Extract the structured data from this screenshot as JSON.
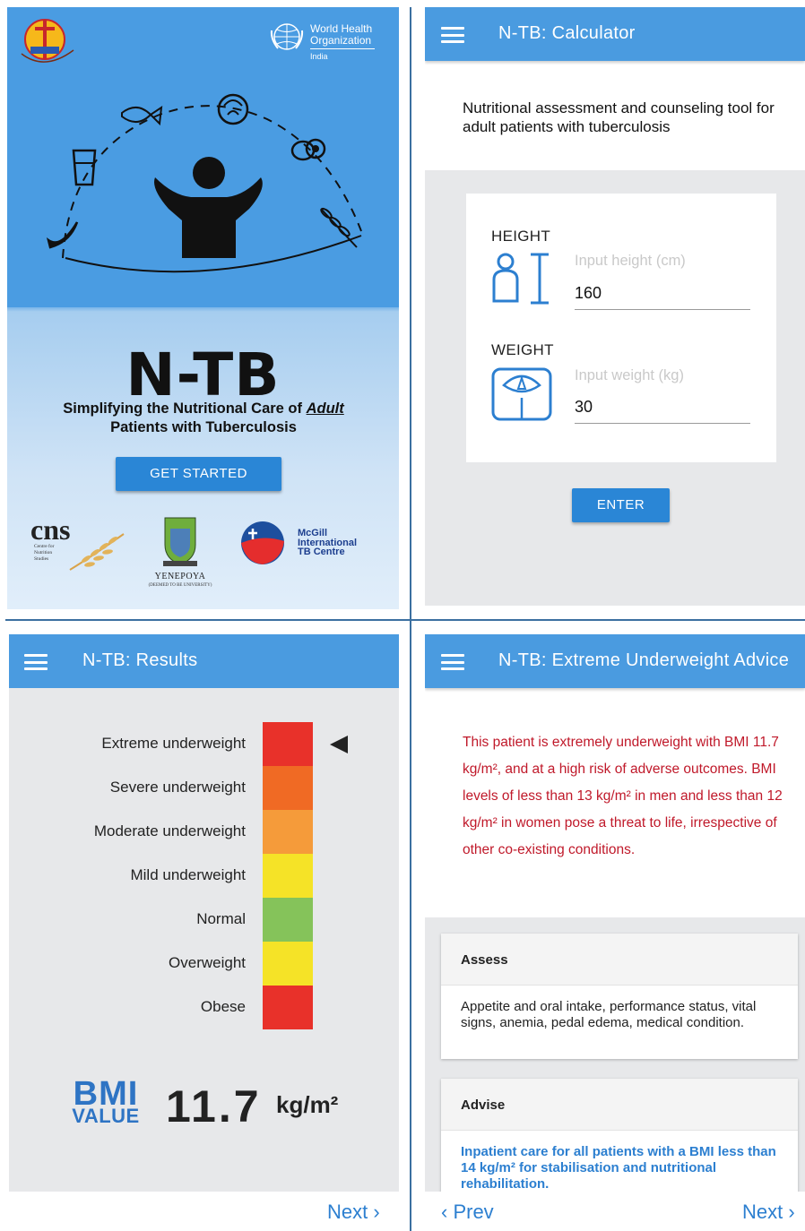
{
  "splash": {
    "org_name_1": "World Health",
    "org_name_2": "Organization",
    "org_country": "India",
    "app_title": "N-TB",
    "subtitle_1": "Simplifying the Nutritional Care of ",
    "subtitle_em": "Adult",
    "subtitle_2": "Patients with Tuberculosis",
    "cta": "GET STARTED",
    "partner_cns": "cns",
    "partner_cns_sub": [
      "Centre for",
      "Nutrition",
      "Studies"
    ],
    "partner_yenepoya": "YENEPOYA",
    "partner_yenepoya_sub": "(DEEMED TO BE UNIVERSITY)",
    "partner_mcgill": [
      "McGill",
      "International",
      "TB Centre"
    ]
  },
  "calculator": {
    "title": "N-TB: Calculator",
    "intro": "Nutritional assessment and counseling tool for adult patients with tuberculosis",
    "height_label": "HEIGHT",
    "height_placeholder": "Input height (cm)",
    "height_value": "160",
    "weight_label": "WEIGHT",
    "weight_placeholder": "Input weight (kg)",
    "weight_value": "30",
    "enter_label": "ENTER"
  },
  "results": {
    "title": "N-TB: Results",
    "categories": [
      {
        "label": "Extreme underweight",
        "color": "#e8312a"
      },
      {
        "label": "Severe underweight",
        "color": "#f06a24"
      },
      {
        "label": "Moderate underweight",
        "color": "#f59b3a"
      },
      {
        "label": "Mild underweight",
        "color": "#f5e327"
      },
      {
        "label": "Normal",
        "color": "#85c35a"
      },
      {
        "label": "Overweight",
        "color": "#f5e327"
      },
      {
        "label": "Obese",
        "color": "#e8312a"
      }
    ],
    "selected_category": "Extreme underweight",
    "bmi_word": "BMI",
    "bmi_value_word": "VALUE",
    "bmi_value": "11.7",
    "bmi_unit": "kg/m²",
    "next_label": "Next ›"
  },
  "advice": {
    "title": "N-TB: Extreme Underweight Advice",
    "message": "This patient is extremely underweight with BMI 11.7 kg/m², and at a high risk of adverse outcomes. BMI levels of less than 13 kg/m² in men and less than 12 kg/m²  in women pose a threat to life, irrespective of other co-existing conditions.",
    "assess_title": "Assess",
    "assess_body": "Appetite and oral intake, performance status, vital signs, anemia, pedal edema, medical condition.",
    "advise_title": "Advise",
    "advise_body": "Inpatient care for all patients with a BMI less than 14 kg/m² for stabilisation and nutritional rehabilitation.",
    "prev_label": "‹ Prev",
    "next_label": "Next ›"
  },
  "colors": {
    "appbar": "#4a9be0",
    "button": "#2a86d6",
    "link": "#2c7fd0",
    "alert_text": "#c0192a",
    "bmi_blue": "#2e74c4"
  }
}
